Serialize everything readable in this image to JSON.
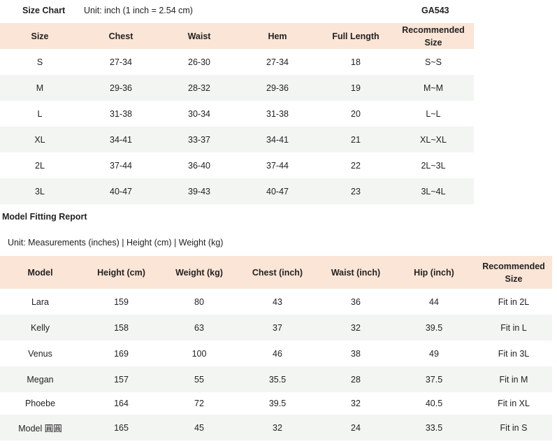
{
  "size_chart": {
    "title": "Size Chart",
    "unit": "Unit: inch (1 inch = 2.54 cm)",
    "code": "GA543",
    "columns": [
      "Size",
      "Chest",
      "Waist",
      "Hem",
      "Full Length",
      "Recommended Size"
    ],
    "rows": [
      [
        "S",
        "27-34",
        "26-30",
        "27-34",
        "18",
        "S~S"
      ],
      [
        "M",
        "29-36",
        "28-32",
        "29-36",
        "19",
        "M~M"
      ],
      [
        "L",
        "31-38",
        "30-34",
        "31-38",
        "20",
        "L~L"
      ],
      [
        "XL",
        "34-41",
        "33-37",
        "34-41",
        "21",
        "XL~XL"
      ],
      [
        "2L",
        "37-44",
        "36-40",
        "37-44",
        "22",
        "2L~3L"
      ],
      [
        "3L",
        "40-47",
        "39-43",
        "40-47",
        "23",
        "3L~4L"
      ]
    ]
  },
  "model_report": {
    "title": "Model Fitting Report",
    "unit": "Unit: Measurements (inches) | Height (cm) | Weight (kg)",
    "columns": [
      "Model",
      "Height (cm)",
      "Weight (kg)",
      "Chest (inch)",
      "Waist (inch)",
      "Hip (inch)",
      "Recommended Size"
    ],
    "rows": [
      [
        "Lara",
        "159",
        "80",
        "43",
        "36",
        "44",
        "Fit in 2L"
      ],
      [
        "Kelly",
        "158",
        "63",
        "37",
        "32",
        "39.5",
        "Fit in L"
      ],
      [
        "Venus",
        "169",
        "100",
        "46",
        "38",
        "49",
        "Fit in 3L"
      ],
      [
        "Megan",
        "157",
        "55",
        "35.5",
        "28",
        "37.5",
        "Fit in M"
      ],
      [
        "Phoebe",
        "164",
        "72",
        "39.5",
        "32",
        "40.5",
        "Fit in XL"
      ],
      [
        "Model 圓圓",
        "165",
        "45",
        "32",
        "24",
        "33.5",
        "Fit in S"
      ]
    ]
  }
}
